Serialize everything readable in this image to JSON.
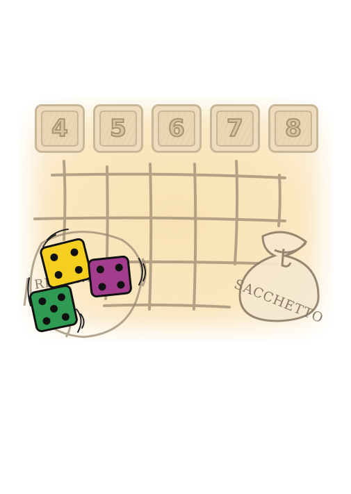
{
  "number_tiles": [
    {
      "label": "4"
    },
    {
      "label": "5"
    },
    {
      "label": "6"
    },
    {
      "label": "7"
    },
    {
      "label": "8"
    }
  ],
  "bag": {
    "label": "SACCHETTO"
  },
  "tray": {
    "label": "RISERVA"
  },
  "dice": [
    {
      "color": "#f4cf1e",
      "pips": 4
    },
    {
      "color": "#a23c8c",
      "pips": 4
    },
    {
      "color": "#2f9a52",
      "pips": 5
    }
  ],
  "colors": {
    "board": "#f8e2b4",
    "ink": "#8a7a66",
    "tile": "#efdcbc"
  }
}
